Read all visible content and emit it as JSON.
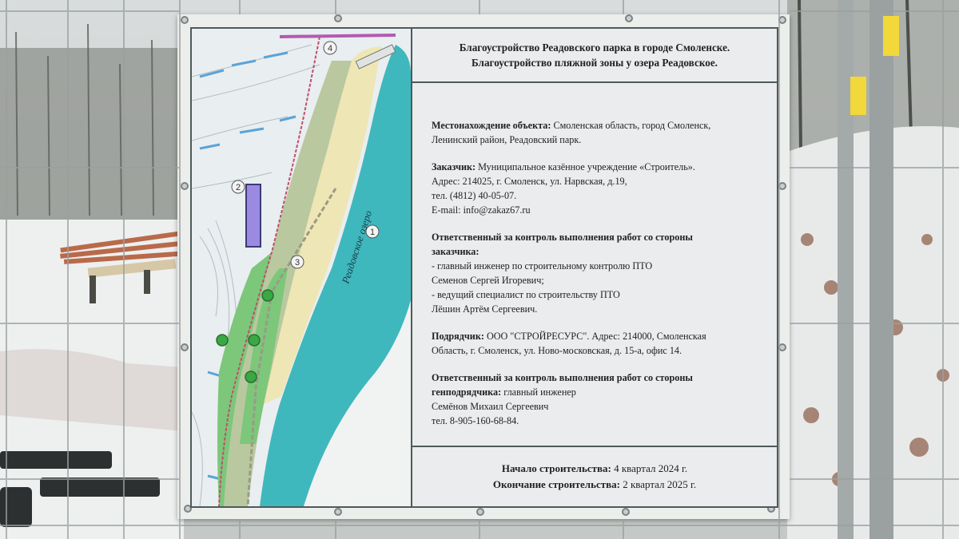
{
  "title": {
    "line1": "Благоустройство Реадовского парка в городе Смоленске.",
    "line2": "Благоустройство пляжной зоны у озера Реадовское."
  },
  "map": {
    "lake_label": "Реадовское озеро",
    "markers": [
      "1",
      "2",
      "3",
      "4"
    ]
  },
  "location": {
    "label": "Местонахождение объекта:",
    "text1": " Смоленская область, город Смоленск,",
    "text2": "Ленинский район, Реадовский парк."
  },
  "client": {
    "label": "Заказчик:",
    "text1": " Муниципальное казённое учреждение «Строитель».",
    "address": "Адрес: 214025, г. Смоленск, ул. Нарвская, д.19,",
    "phone": "тел. (4812) 40-05-07.",
    "email": "E-mail: info@zakaz67.ru"
  },
  "client_responsible": {
    "label1": "Ответственный за контроль выполнения работ со стороны",
    "label2": "заказчика:",
    "p1": "- главный инженер по строительному контролю ПТО",
    "p1_name": "Семенов Сергей Игоревич;",
    "p2": "- ведущий специалист по строительству ПТО",
    "p2_name": "Лёшин Артём Сергеевич."
  },
  "contractor": {
    "label": "Подрядчик:",
    "text1": " ООО \"СТРОЙРЕСУРС\". Адрес: 214000, Смоленская",
    "text2": "Область, г. Смоленск, ул. Ново-московская, д. 15-а, офис 14."
  },
  "contractor_responsible": {
    "label1": "Ответственный за контроль выполнения работ со стороны",
    "label2": "генподрядчика:",
    "role": " главный инженер",
    "name": "Семёнов Михаил Сергеевич",
    "phone": "тел. 8-905-160-68-84."
  },
  "schedule": {
    "start_label": "Начало строительства:",
    "start_value": " 4 квартал 2024 г.",
    "end_label": "Окончание строительства:",
    "end_value": " 2 квартал 2025 г."
  },
  "colors": {
    "lake": "#3fb8bd",
    "greenery": "#7cc77a",
    "sand": "#eee6b4",
    "banner": "#eceeec",
    "snow": "#eef0f0"
  }
}
